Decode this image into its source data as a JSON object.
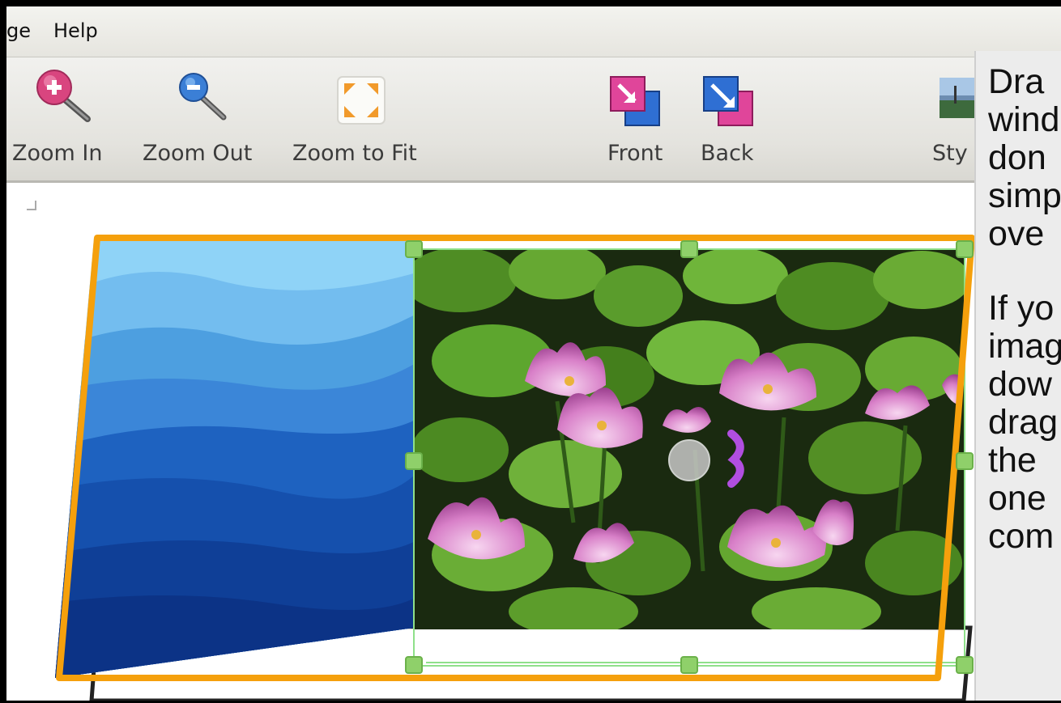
{
  "menu": {
    "items": [
      "ge",
      "Help"
    ]
  },
  "toolbar": {
    "zoom_in": "Zoom In",
    "zoom_out": "Zoom Out",
    "zoom_fit": "Zoom to Fit",
    "front": "Front",
    "back": "Back",
    "style": "Sty"
  },
  "tip": {
    "para1": "Dra\nwind\ndon\nsimp\nove",
    "para2": "If yo\nimag\ndow\ndrag\nthe\none\ncom"
  },
  "colors": {
    "selection_frame": "#f5a00c",
    "handle": "#8fd06a",
    "toolbar_bg": "#e6e5df"
  },
  "icons": {
    "zoom_in": "magnifier-plus-icon",
    "zoom_out": "magnifier-minus-icon",
    "zoom_fit": "expand-arrows-icon",
    "front": "bring-to-front-icon",
    "back": "send-to-back-icon",
    "style": "landscape-thumbnail-icon"
  }
}
